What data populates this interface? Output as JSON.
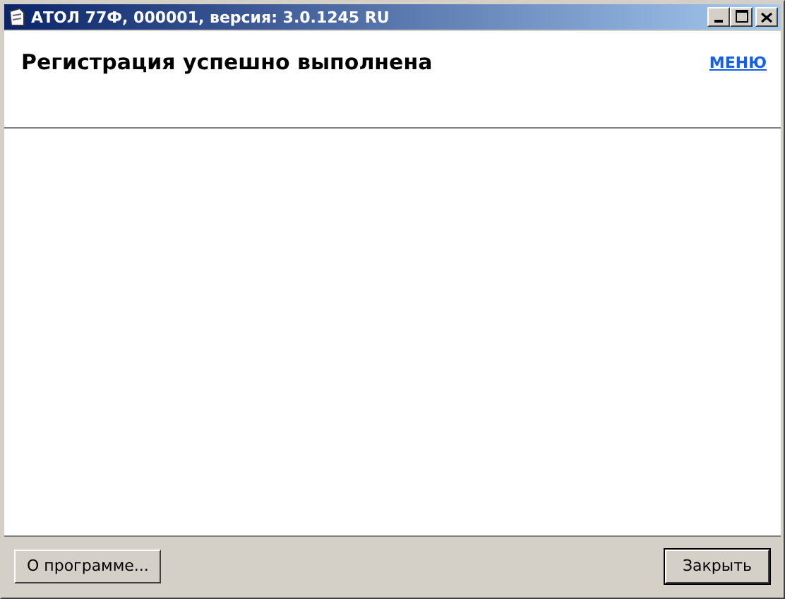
{
  "window": {
    "title": "АТОЛ 77Ф, 000001, версия: 3.0.1245 RU"
  },
  "header": {
    "heading": "Регистрация успешно выполнена",
    "menu_link": "МЕНЮ"
  },
  "buttons": [
    {
      "label": "О программе...",
      "default": false
    },
    {
      "label": "Закрыть",
      "default": true
    }
  ]
}
